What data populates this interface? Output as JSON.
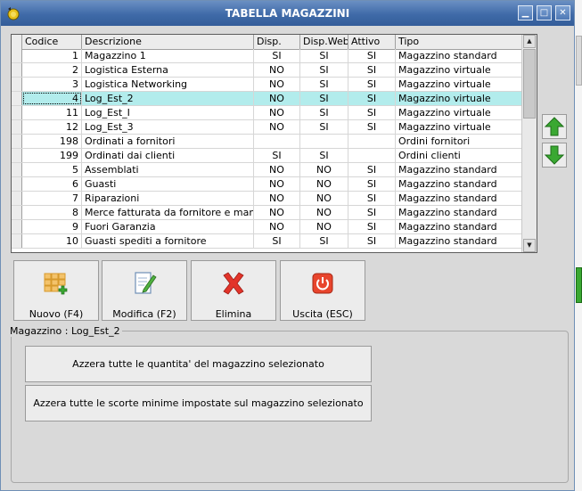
{
  "window": {
    "title": "TABELLA MAGAZZINI"
  },
  "grid": {
    "columns": [
      "Codice",
      "Descrizione",
      "Disp.",
      "Disp.Web",
      "Attivo",
      "Tipo"
    ],
    "rows": [
      {
        "codice": "1",
        "descrizione": "Magazzino 1",
        "disp": "SI",
        "disp_web": "SI",
        "attivo": "SI",
        "tipo": "Magazzino standard"
      },
      {
        "codice": "2",
        "descrizione": "Logistica Esterna",
        "disp": "NO",
        "disp_web": "SI",
        "attivo": "SI",
        "tipo": "Magazzino virtuale"
      },
      {
        "codice": "3",
        "descrizione": "Logistica Networking",
        "disp": "NO",
        "disp_web": "SI",
        "attivo": "SI",
        "tipo": "Magazzino virtuale"
      },
      {
        "codice": "4",
        "descrizione": "Log_Est_2",
        "disp": "NO",
        "disp_web": "SI",
        "attivo": "SI",
        "tipo": "Magazzino virtuale",
        "selected": true
      },
      {
        "codice": "11",
        "descrizione": "Log_Est_I",
        "disp": "NO",
        "disp_web": "SI",
        "attivo": "SI",
        "tipo": "Magazzino virtuale"
      },
      {
        "codice": "12",
        "descrizione": "Log_Est_3",
        "disp": "NO",
        "disp_web": "SI",
        "attivo": "SI",
        "tipo": "Magazzino virtuale"
      },
      {
        "codice": "198",
        "descrizione": "Ordinati a fornitori",
        "disp": "",
        "disp_web": "",
        "attivo": "",
        "tipo": "Ordini fornitori"
      },
      {
        "codice": "199",
        "descrizione": "Ordinati dai clienti",
        "disp": "SI",
        "disp_web": "SI",
        "attivo": "",
        "tipo": "Ordini clienti"
      },
      {
        "codice": "5",
        "descrizione": "Assemblati",
        "disp": "NO",
        "disp_web": "NO",
        "attivo": "SI",
        "tipo": "Magazzino standard"
      },
      {
        "codice": "6",
        "descrizione": "Guasti",
        "disp": "NO",
        "disp_web": "NO",
        "attivo": "SI",
        "tipo": "Magazzino standard"
      },
      {
        "codice": "7",
        "descrizione": "Riparazioni",
        "disp": "NO",
        "disp_web": "NO",
        "attivo": "SI",
        "tipo": "Magazzino standard"
      },
      {
        "codice": "8",
        "descrizione": "Merce fatturata da fornitore e manc…",
        "disp": "NO",
        "disp_web": "NO",
        "attivo": "SI",
        "tipo": "Magazzino standard"
      },
      {
        "codice": "9",
        "descrizione": "Fuori Garanzia",
        "disp": "NO",
        "disp_web": "NO",
        "attivo": "SI",
        "tipo": "Magazzino standard"
      },
      {
        "codice": "10",
        "descrizione": "Guasti spediti a fornitore",
        "disp": "SI",
        "disp_web": "SI",
        "attivo": "SI",
        "tipo": "Magazzino standard"
      }
    ]
  },
  "toolbar": {
    "new_label": "Nuovo (F4)",
    "edit_label": "Modifica (F2)",
    "delete_label": "Elimina",
    "exit_label": "Uscita (ESC)"
  },
  "details": {
    "group_title": "Magazzino : Log_Est_2",
    "reset_qty_label": "Azzera tutte le quantita' del magazzino selezionato",
    "reset_min_label": "Azzera tutte le scorte minime impostate sul magazzino selezionato"
  },
  "colors": {
    "titlebar": "#3f6aa8",
    "selected_row": "#b2ecec",
    "arrow_green": "#3aa832"
  },
  "icons": {
    "app": "coin-icon",
    "new": "grid-add-icon",
    "edit": "document-edit-icon",
    "delete": "red-x-icon",
    "exit": "power-icon",
    "move_up": "green-up-arrow-icon",
    "move_down": "green-down-arrow-icon"
  }
}
